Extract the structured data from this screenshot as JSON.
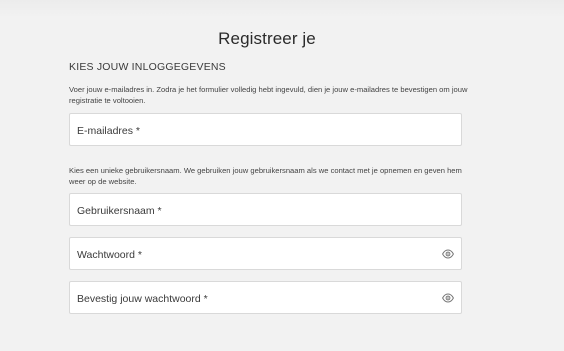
{
  "page": {
    "title": "Registreer je",
    "section_heading": "KIES JOUW INLOGGEGEVENS"
  },
  "email": {
    "helper": "Voer jouw e-mailadres in. Zodra je het formulier volledig hebt ingevuld, dien je jouw e-mailadres te bevestigen om jouw registratie te voltooien.",
    "label": "E-mailadres *"
  },
  "username": {
    "helper": "Kies een unieke gebruikersnaam. We gebruiken jouw gebruikersnaam als we contact met je opnemen en geven hem weer op de website.",
    "label": "Gebruikersnaam *"
  },
  "password": {
    "label": "Wachtwoord *",
    "icon": "eye-icon"
  },
  "confirm_password": {
    "label": "Bevestig jouw wachtwoord *",
    "icon": "eye-icon"
  }
}
